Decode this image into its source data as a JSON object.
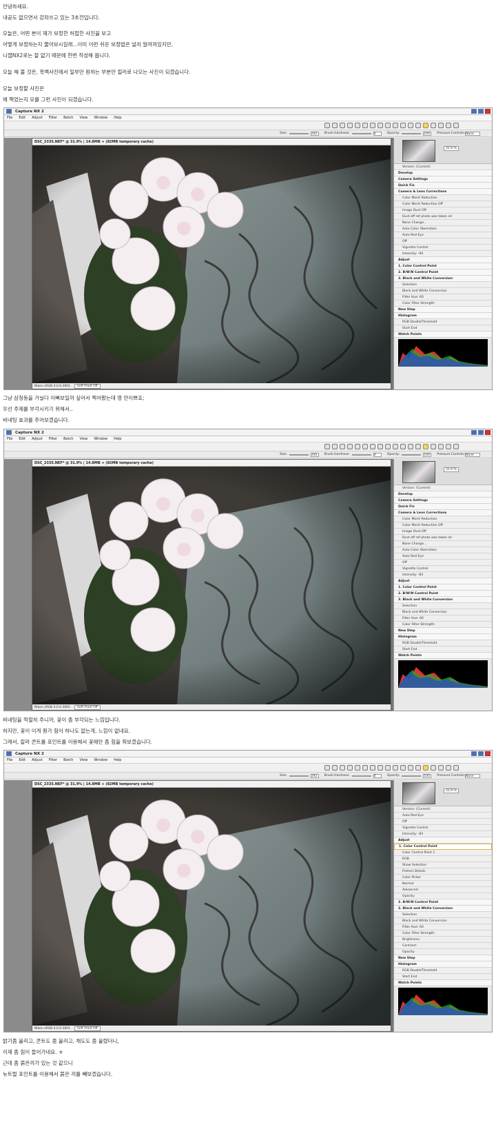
{
  "paragraphs": [
    {
      "text": "안녕하세요."
    },
    {
      "text": "내공도 없으면서 강좌쓰고 있는 3초전입니다."
    },
    {
      "text": "오늘은, 어떤 분이 제가 보정한 허접한 사진을 보고"
    },
    {
      "text": "어떻게 보정하는지 물어보시길래...이미 이런 쉬운 보정법은 널리 알려져있지만,"
    },
    {
      "text": "니캡NX2로는 잘 없기 때문에 한번 작성해 봅니다."
    },
    {
      "text": "오늘 해 볼 것은, 흑백사진에서 일부만 원하는 부분만 컬러로 나오는 사진이 되겠습니다."
    },
    {
      "text": "오늘 보정할 사진은"
    },
    {
      "text": "왜 찍었는지 모를 그런 사진이 되겠습니다."
    },
    {
      "text": "그냥 삼청동을 거닐다 이뻐보일까 싶어서 찍어봤는데 영 안이쁘죠;"
    },
    {
      "text": "우선 주제를 부각시키기 위해서.."
    },
    {
      "text": "비네팅 효과를 주어보겠습니다."
    },
    {
      "text": "비네팅을 적절히 주니까, 꽃이 좀 부각되는 느낌입니다."
    },
    {
      "text": "하지만, 꽃이 이게 뭔가 힘이 하나도 없는게, 느낌이 없네요."
    },
    {
      "text": "그래서, 칼라 콘트롤 포인트를 이용해서 꽃에만 좀 힘을 줘보겠습니다."
    },
    {
      "text": "밝기좀 올리고, 콘트도 좀 올리고, 채도도 좀 올렸더니,"
    },
    {
      "text": "이제 좀 힘이 들어가네요. ㅎ"
    },
    {
      "text": "근데 좀 붉은끼가 있는 것 같으니"
    },
    {
      "text": "뉴트럴 포인트를 이용해서 붉은 끼를 빼보겠습니다."
    }
  ],
  "app": {
    "title": "Capture NX 2",
    "menu": [
      "File",
      "Edit",
      "Adjust",
      "Filter",
      "Batch",
      "View",
      "Window",
      "Help"
    ],
    "toolbar": {
      "size_label": "Size:",
      "size_value": "192",
      "hardness_label": "Brush Hardness:",
      "hardness_value": "0",
      "opacity_label": "Opacity:",
      "opacity_value": "100",
      "pressure_label": "Pressure Controls:",
      "pressure_value": "None"
    },
    "document": {
      "title": "DSC_2335.NEF* @ 31.9% | 14.8MB + (82MB temporary cache)",
      "profile": "Nikon sRGB 4.0.0.3001",
      "softproof": "Soft Proof Off"
    },
    "zoom": "31.9 %"
  },
  "screens": [
    {
      "palette": [
        "Version: (Current)",
        "Develop",
        "Camera Settings",
        "Quick Fix",
        "Camera & Lens Corrections",
        "Color Moiré Reduction",
        "Color Moiré Reduction  Off",
        "Image Dust Off",
        "Dust off ref photo was taken at:",
        "None   Change...",
        "Auto Color Aberration",
        "Auto Red-Eye",
        "Off",
        "Vignette Control",
        "Intensity: -94",
        "Adjust",
        "1. Color Control Point",
        "2. B/W/N Control Point",
        "3. Black and White Conversion",
        "Selection",
        "Black and White Conversion",
        "Filter Hue: 60",
        "Color Filter Strength:",
        "New Step",
        "Histogram",
        "RGB   DoubleThreshold",
        "Start   End",
        "Watch Points"
      ]
    },
    {
      "palette": [
        "Version: (Current)",
        "Develop",
        "Camera Settings",
        "Quick Fix",
        "Camera & Lens Corrections",
        "Color Moiré Reduction",
        "Color Moiré Reduction  Off",
        "Image Dust Off",
        "Dust off ref photo was taken at:",
        "None   Change...",
        "Auto Color Aberration",
        "Auto Red-Eye",
        "Off",
        "Vignette Control",
        "Intensity: -83",
        "Adjust",
        "1. Color Control Point",
        "2. B/W/N Control Point",
        "3. Black and White Conversion",
        "Selection",
        "Black and White Conversion",
        "Filter Hue: 60",
        "Color Filter Strength:",
        "New Step",
        "Histogram",
        "RGB   DoubleThreshold",
        "Start   End",
        "Watch Points"
      ]
    },
    {
      "palette": [
        "Version: (Current)",
        "Auto Red-Eye",
        "Off",
        "Vignette Control",
        "Intensity: -83",
        "Adjust",
        "1. Color Control Point",
        "Color Control Point 1",
        "RGB",
        "Show Selection",
        "Protect Details",
        "Color Picker",
        "Normal",
        "Advanced",
        "Opacity",
        "2. B/W/N Control Point",
        "3. Black and White Conversion",
        "Selection",
        "Black and White Conversion",
        "Filter Hue: 60",
        "Color Filter Strength:",
        "Brightness:",
        "Contrast:",
        "Opacity",
        "New Step",
        "Histogram",
        "RGB   DoubleThreshold",
        "Start   End",
        "Watch Points"
      ]
    }
  ]
}
